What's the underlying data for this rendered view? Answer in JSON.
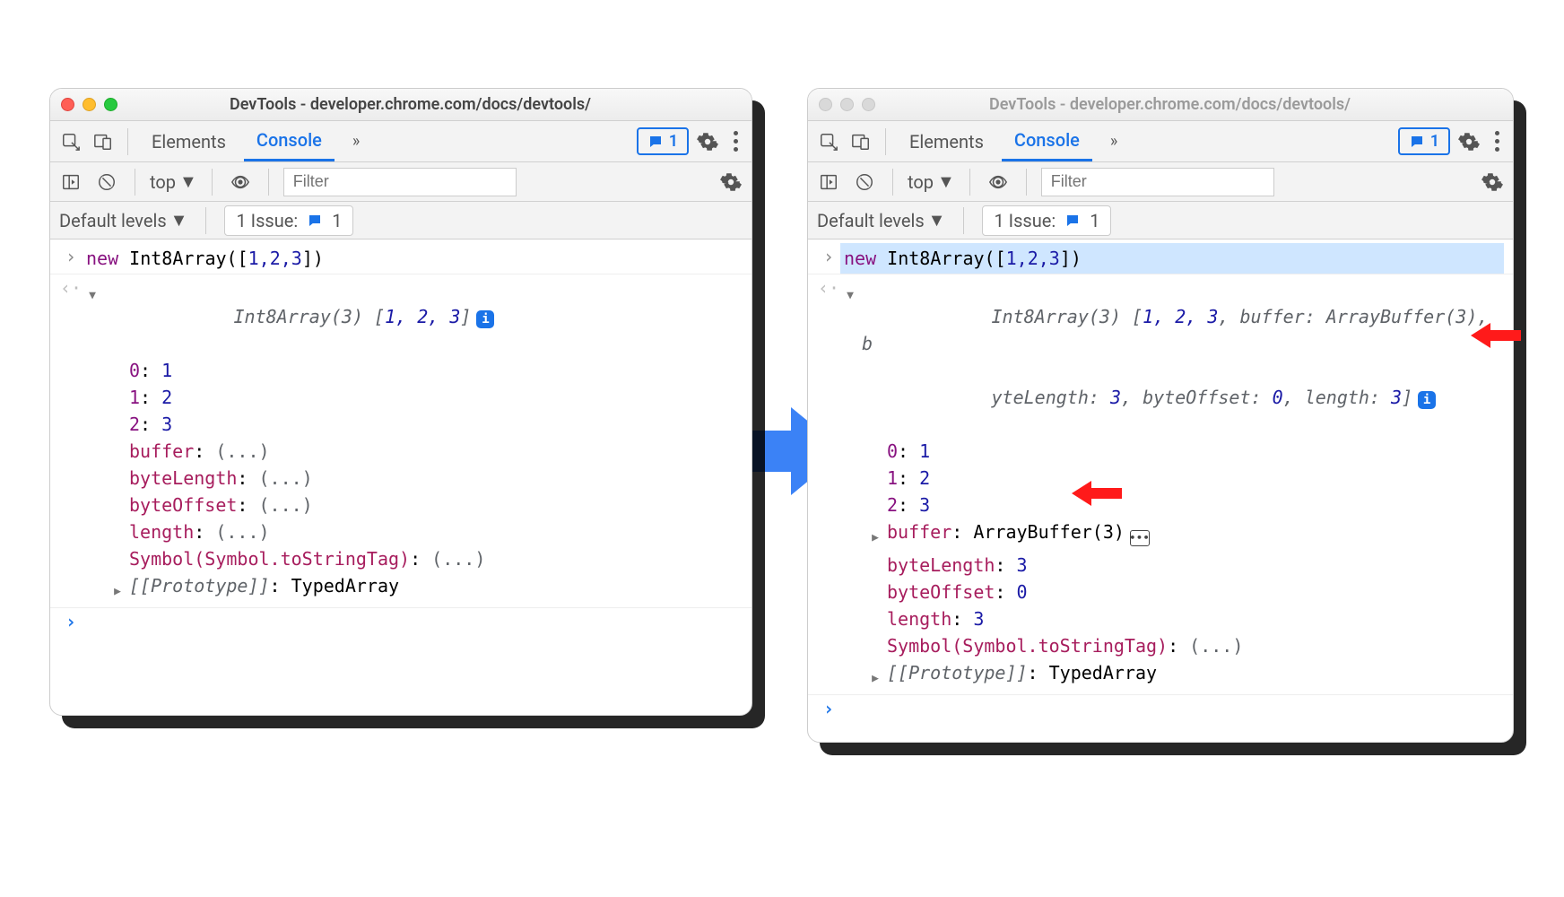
{
  "windowTitle": "DevTools - developer.chrome.com/docs/devtools/",
  "tabs": {
    "elements": "Elements",
    "console": "Console"
  },
  "msgCount": "1",
  "ctx": "top",
  "filterPlaceholder": "Filter",
  "levels": "Default levels",
  "issue": {
    "prefix": "1 Issue:",
    "count": "1"
  },
  "left": {
    "input": {
      "kw": "new",
      "call": " Int8Array([",
      "args": "1,2,3",
      "tail": "])"
    },
    "preview": {
      "head": "Int8Array(3) [",
      "vals": "1, 2, 3",
      "tail": "]"
    },
    "tree": {
      "idx": [
        {
          "k": "0",
          "v": "1"
        },
        {
          "k": "1",
          "v": "2"
        },
        {
          "k": "2",
          "v": "3"
        }
      ],
      "lazy": [
        {
          "k": "buffer",
          "v": "(...)"
        },
        {
          "k": "byteLength",
          "v": "(...)"
        },
        {
          "k": "byteOffset",
          "v": "(...)"
        },
        {
          "k": "length",
          "v": "(...)"
        },
        {
          "k": "Symbol(Symbol.toStringTag)",
          "v": "(...)"
        }
      ],
      "proto": {
        "k": "[[Prototype]]",
        "v": "TypedArray"
      }
    }
  },
  "right": {
    "input": {
      "kw": "new",
      "call": " Int8Array([",
      "args": "1,2,3",
      "tail": "])"
    },
    "preview": {
      "head": "Int8Array(3) [",
      "line1a": "1, 2, 3",
      "line1b": ", buffer: ",
      "line1c": "ArrayBuffer(3)",
      "line1d": ", b",
      "line2a": "yteLength: ",
      "line2b": "3",
      "line2c": ", byteOffset: ",
      "line2d": "0",
      "line2e": ", length: ",
      "line2f": "3",
      "tail": "]"
    },
    "tree": {
      "idx": [
        {
          "k": "0",
          "v": "1"
        },
        {
          "k": "1",
          "v": "2"
        },
        {
          "k": "2",
          "v": "3"
        }
      ],
      "buffer": {
        "k": "buffer",
        "v": "ArrayBuffer(3)"
      },
      "resolved": [
        {
          "k": "byteLength",
          "v": "3"
        },
        {
          "k": "byteOffset",
          "v": "0"
        },
        {
          "k": "length",
          "v": "3"
        },
        {
          "k": "Symbol(Symbol.toStringTag)",
          "v": "(...)"
        }
      ],
      "proto": {
        "k": "[[Prototype]]",
        "v": "TypedArray"
      }
    }
  }
}
